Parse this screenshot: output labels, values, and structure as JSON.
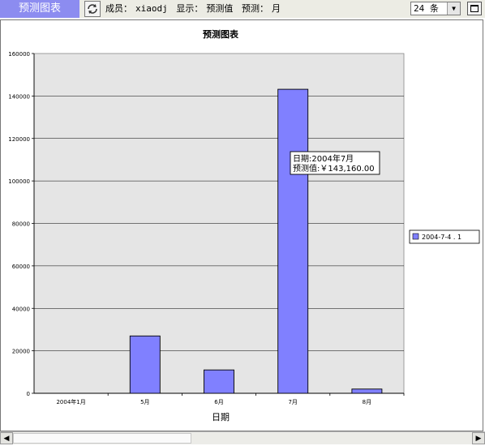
{
  "header": {
    "app_title": "预测图表",
    "member_label": "成员：",
    "member_value": "xiaodj",
    "display_label": "显示：",
    "display_value": "预测值",
    "forecast_label": "预测：",
    "forecast_value": "月",
    "select_value": "24 条"
  },
  "icons": {
    "refresh": "refresh-icon",
    "maximize": "maximize-icon",
    "scroll_left": "arrow-left-icon",
    "scroll_right": "arrow-right-icon"
  },
  "colors": {
    "bar": "#8080ff",
    "plot_bg": "#e5e5e5",
    "title_bar": "#8c8cf0"
  },
  "chart_data": {
    "type": "bar",
    "title": "预测图表",
    "xlabel": "日期",
    "ylabel": "",
    "categories": [
      "2004年1月",
      "5月",
      "6月",
      "7月",
      "8月"
    ],
    "values": [
      0,
      27000,
      11000,
      143160,
      2000
    ],
    "ylim": [
      0,
      160000
    ],
    "yticks": [
      0,
      20000,
      40000,
      60000,
      80000,
      100000,
      120000,
      140000,
      160000
    ],
    "grid": true,
    "legend": {
      "position": "right",
      "entries": [
        "2004-7-4 . 1"
      ]
    },
    "tooltip": {
      "line1": "日期:2004年7月",
      "line2": "预测值:￥143,160.00",
      "category_index": 3
    }
  }
}
